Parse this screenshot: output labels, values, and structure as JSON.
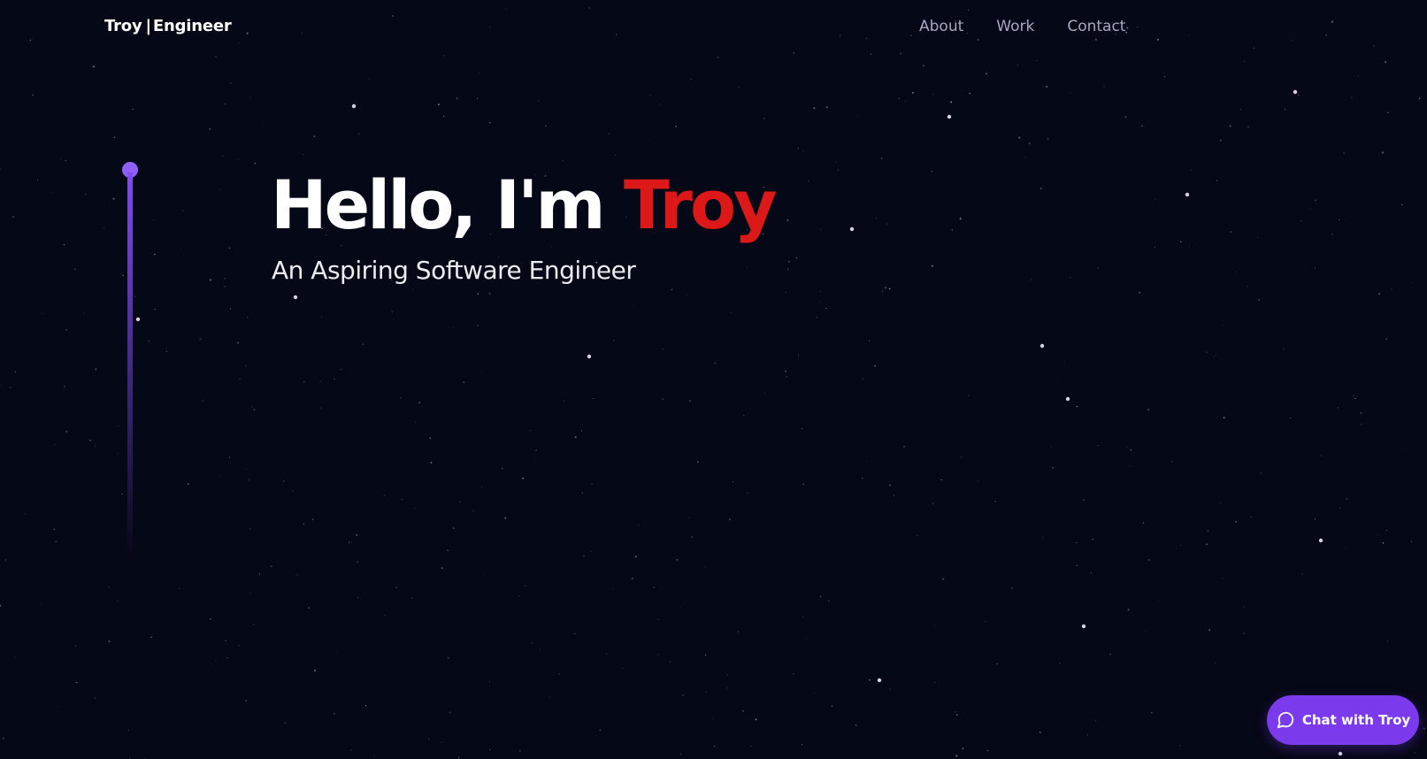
{
  "navbar": {
    "brand_name": "Troy",
    "brand_separator": "|",
    "brand_role": "Engineer",
    "links": [
      "About",
      "Work",
      "Contact"
    ]
  },
  "hero": {
    "greeting": "Hello, I'm ",
    "name": "Troy",
    "subtitle": "An Aspiring Software Engineer"
  },
  "chat": {
    "label": "Chat with Troy",
    "icon": "chat-bubble-icon"
  },
  "colors": {
    "background": "#050816",
    "accent": "#915eff",
    "name_highlight": "#dc1818",
    "chat_button": "#7c3aed",
    "nav_text": "#aaa6c3"
  }
}
